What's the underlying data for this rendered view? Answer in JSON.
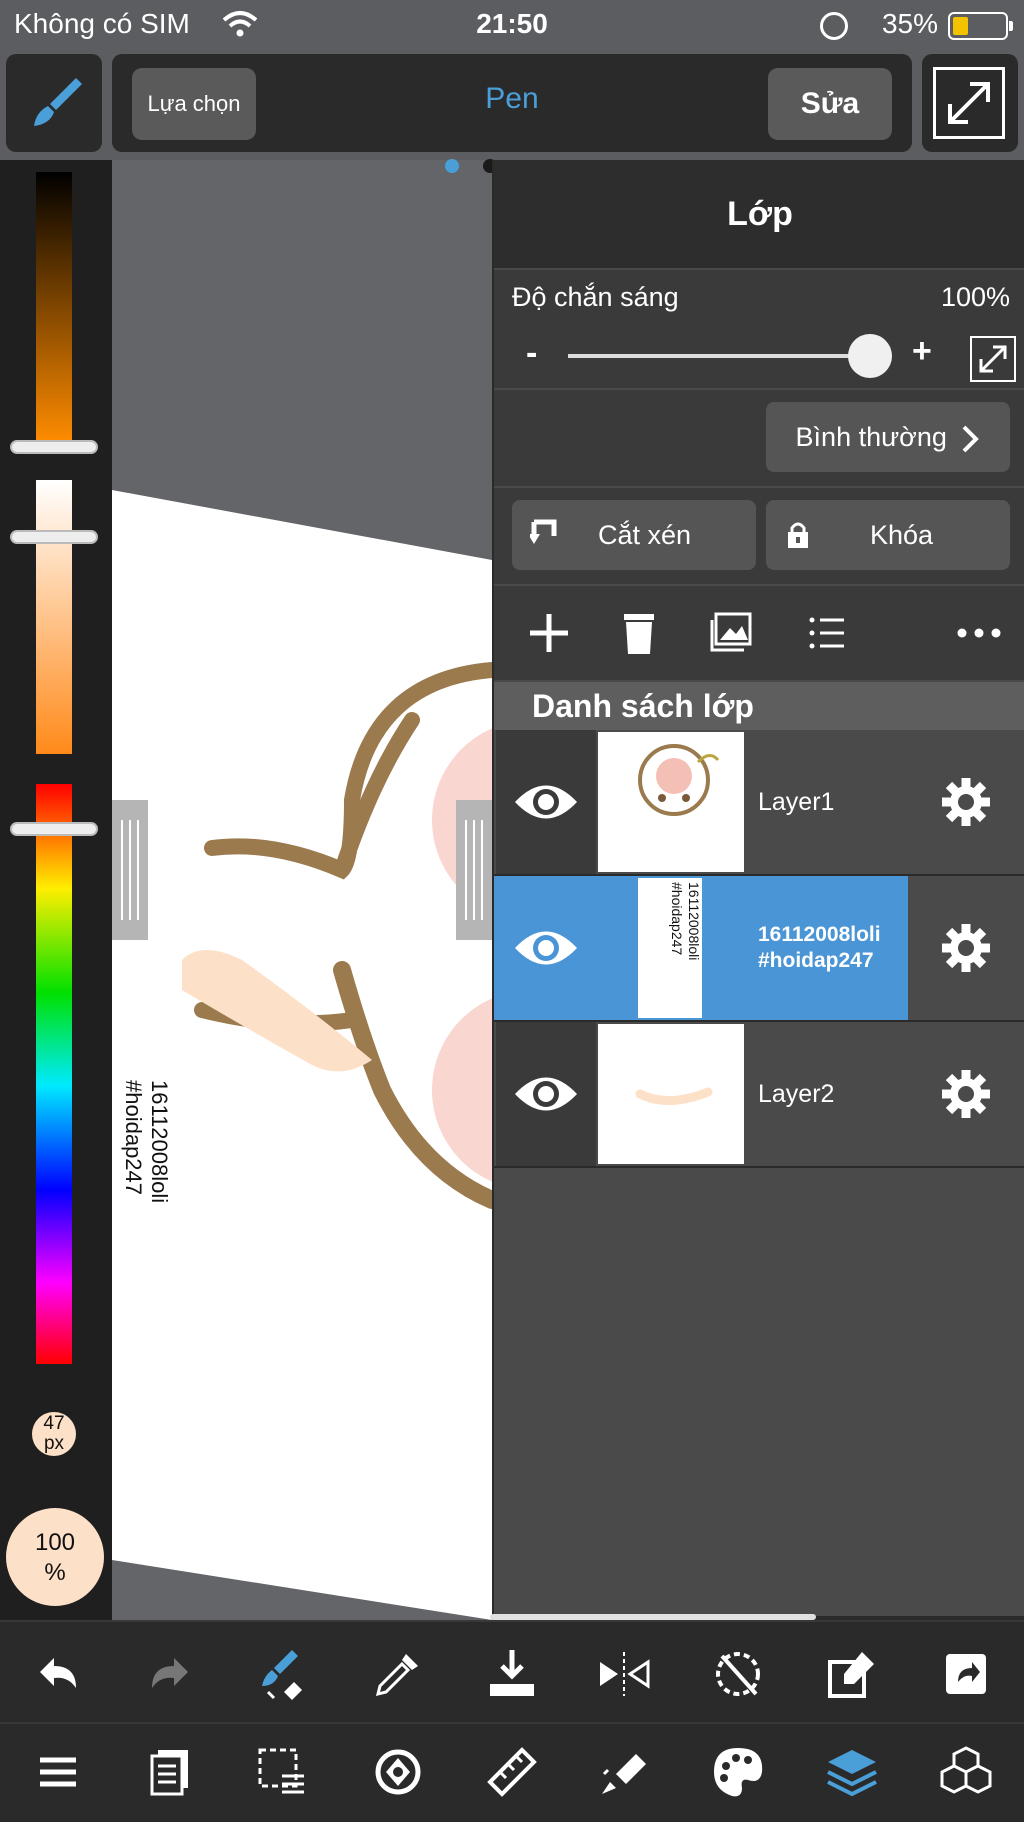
{
  "status_bar": {
    "carrier": "Không có SIM",
    "time": "21:50",
    "battery": "35%",
    "battery_level": 0.35,
    "battery_color": "#f3c300"
  },
  "toolbar": {
    "select_label": "Lựa chọn",
    "tool_name": "Pen",
    "edit_label": "Sửa",
    "brush_icon": "brush-icon",
    "expand_icon": "expand-icon"
  },
  "colors": {
    "accent": "#4a9fd8",
    "active_layer": "#4a95d6",
    "panel_bg": "#4a4a4a",
    "brush_color": "#fde0c8"
  },
  "left_panel": {
    "brush_size": "47\npx",
    "brush_size_line1": "47",
    "brush_size_line2": "px",
    "opacity_line1": "100",
    "opacity_line2": "%"
  },
  "canvas_text": {
    "line1": "16112008loli",
    "line2": "#hoidap247"
  },
  "layer_panel": {
    "title": "Lớp",
    "opacity_label": "Độ chắn sáng",
    "opacity_value": "100%",
    "opacity_level": 1.0,
    "minus": "-",
    "plus": "+",
    "blend_mode": "Bình thường",
    "clip_label": "Cắt xén",
    "lock_label": "Khóa",
    "list_header": "Danh sách lớp",
    "actions": [
      "add-icon",
      "trash-icon",
      "image-icon",
      "list-icon",
      "more-icon"
    ],
    "layers": [
      {
        "name": "Layer1",
        "visible": true,
        "active": false
      },
      {
        "name_line1": "16112008loli",
        "name_line2": "#hoidap247",
        "visible": true,
        "active": true
      },
      {
        "name": "Layer2",
        "visible": true,
        "active": false
      }
    ]
  },
  "bottom_toolbar_1": [
    "undo-icon",
    "redo-icon",
    "brush-transform-icon",
    "eyedropper-icon",
    "save-icon",
    "flip-icon",
    "rotate-reset-icon",
    "edit-frame-icon",
    "share-icon"
  ],
  "bottom_toolbar_2": [
    "menu-icon",
    "pages-icon",
    "selection-icon",
    "rotate-icon",
    "ruler-icon",
    "fill-icon",
    "palette-icon",
    "layers-icon",
    "3d-icon"
  ]
}
